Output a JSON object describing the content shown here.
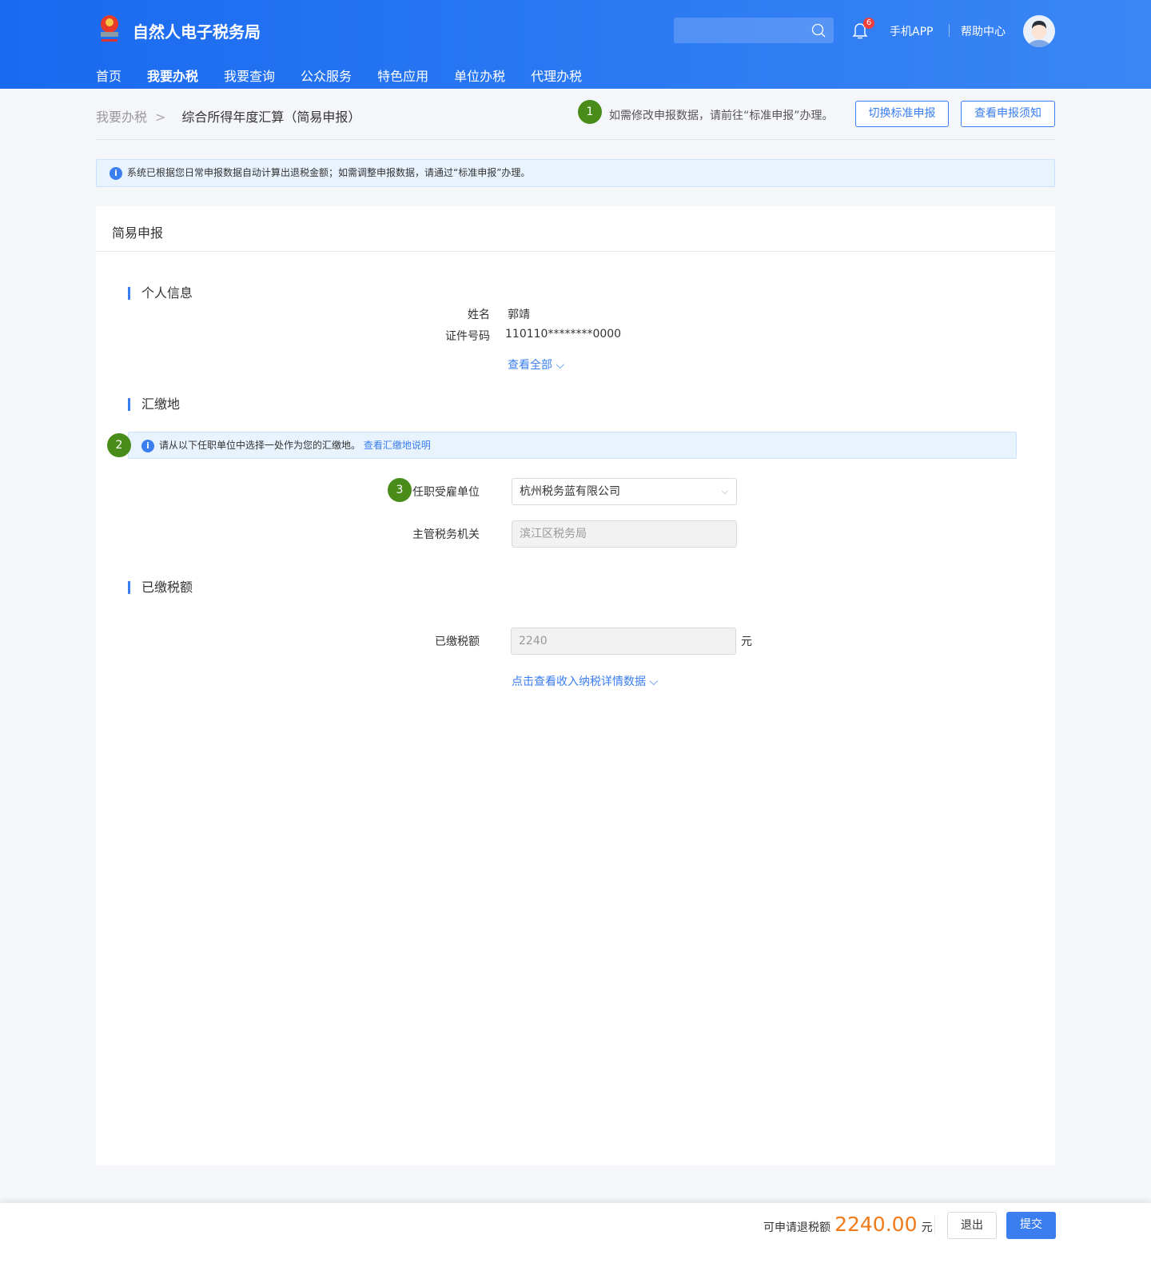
{
  "header": {
    "brand": "自然人电子税务局",
    "search_placeholder": "",
    "notifications": "6",
    "mobile_app": "手机APP",
    "help": "帮助中心"
  },
  "nav": [
    "首页",
    "我要办税",
    "我要查询",
    "公众服务",
    "特色应用",
    "单位办税",
    "代理办税"
  ],
  "breadcrumb": {
    "parent": "我要办税",
    "separator": ">",
    "current": "综合所得年度汇算（简易申报）"
  },
  "tip": {
    "step": "1",
    "text": "如需修改申报数据，请前往“标准申报”办理。"
  },
  "buttons": {
    "switch": "切换标准申报",
    "notice": "查看申报须知",
    "exit": "退出",
    "submit": "提交"
  },
  "alert": "系统已根据您日常申报数据自动计算出退税金额；如需调整申报数据，请通过“标准申报”办理。",
  "card": {
    "title": "简易申报",
    "personal": {
      "title": "个人信息",
      "name_label": "姓名",
      "name": "郭靖",
      "id_label": "证件号码",
      "id": "110110********0000",
      "view_all": "查看全部"
    },
    "location": {
      "title": "汇缴地",
      "step": "2",
      "alert": "请从以下任职单位中选择一处作为您的汇缴地。",
      "alert_link": "查看汇缴地说明",
      "step3": "3",
      "employer_label": "任职受雇单位",
      "employer": "杭州税务蓝有限公司",
      "authority_label": "主管税务机关",
      "authority": "滨江区税务局"
    },
    "paid": {
      "title": "已缴税额",
      "label": "已缴税额",
      "value": "2240",
      "unit": "元",
      "detail_link": "点击查看收入纳税详情数据"
    }
  },
  "footer": {
    "refund_label": "可申请退税额",
    "refund_amount": "2240.00",
    "unit": "元"
  }
}
